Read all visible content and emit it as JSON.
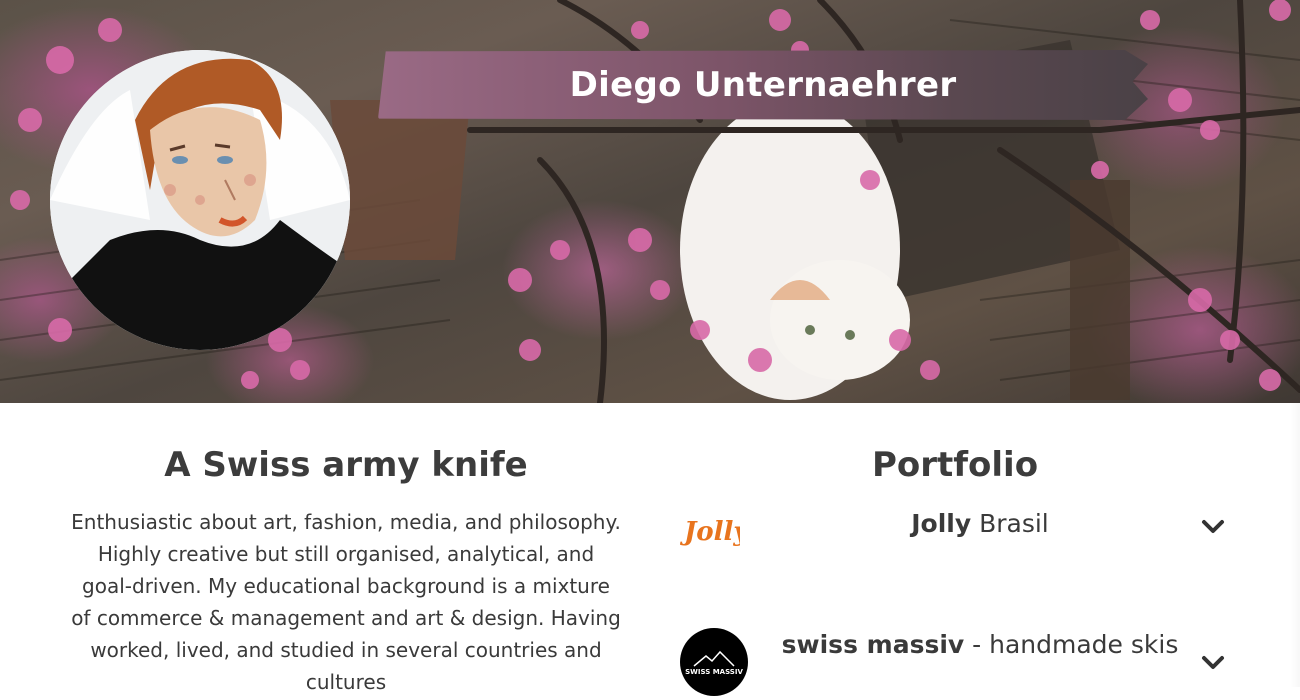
{
  "header": {
    "name": "Diego Unternaehrer"
  },
  "about": {
    "title": "A Swiss army knife",
    "text": "Enthusiastic about art, fashion, media, and philosophy. Highly creative but still organised, analytical, and goal-driven. My educational background is a mixture of commerce & management and art & design. Having worked, lived, and studied in several countries and cultures"
  },
  "portfolio": {
    "title": "Portfolio",
    "items": [
      {
        "brand": "Jolly",
        "rest": " Brasil",
        "logo_text": "Jolly",
        "logo_color": "#e8741e"
      },
      {
        "brand": "swiss massiv",
        "rest": " - handmade skis",
        "logo_text": "SWISS MASSIV",
        "logo_color": "#000000"
      }
    ]
  },
  "icons": {
    "chevron": "chevron-down-icon"
  },
  "colors": {
    "banner_start": "#9a6a85",
    "banner_end": "#4a4146",
    "text": "#3a3a3a",
    "jolly_orange": "#e8741e"
  }
}
